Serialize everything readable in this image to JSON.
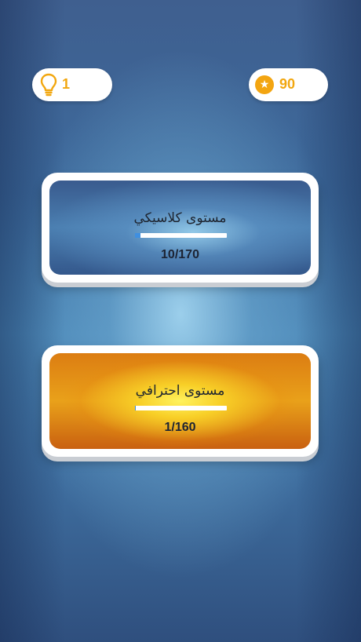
{
  "topbar": {
    "hints": {
      "icon": "lightbulb-icon",
      "value": "1"
    },
    "coins": {
      "icon": "star-coin-icon",
      "glyph": "★",
      "value": "90"
    }
  },
  "levels": [
    {
      "title": "مستوى كلاسيكي",
      "count": "10/170",
      "progress": 0.059,
      "theme": "blue"
    },
    {
      "title": "مستوى احترافي",
      "count": "1/160",
      "progress": 0.006,
      "theme": "orange"
    }
  ],
  "colors": {
    "accent_gold": "#f2a710",
    "progress_fill": "#3f8fe0",
    "card_blue": "#4a7eb0",
    "card_orange": "#e9a11a"
  }
}
